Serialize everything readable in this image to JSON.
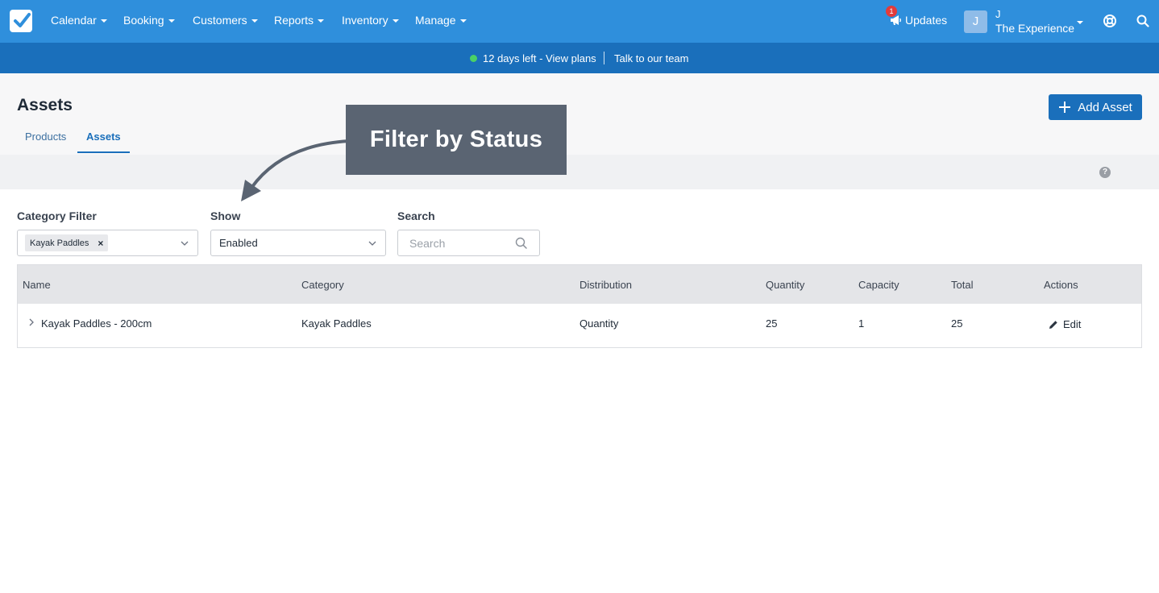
{
  "nav": {
    "items": [
      {
        "label": "Calendar"
      },
      {
        "label": "Booking"
      },
      {
        "label": "Customers"
      },
      {
        "label": "Reports"
      },
      {
        "label": "Inventory"
      },
      {
        "label": "Manage"
      }
    ],
    "updates_label": "Updates",
    "updates_badge": "1",
    "user_avatar_initial": "J",
    "user_name": "J",
    "user_org": "The Experience"
  },
  "banner": {
    "trial_text": "12 days left - View plans",
    "separator": "|",
    "talk_text": "Talk to our team",
    "status_color": "#4ad166"
  },
  "page": {
    "title": "Assets",
    "tabs": [
      {
        "label": "Products",
        "active": false
      },
      {
        "label": "Assets",
        "active": true
      }
    ],
    "add_button_label": "Add Asset",
    "help_glyph": "?"
  },
  "callout": {
    "text": "Filter by Status"
  },
  "filters": {
    "category_label": "Category Filter",
    "category_chip": "Kayak Paddles",
    "chip_remove": "×",
    "show_label": "Show",
    "show_value": "Enabled",
    "search_label": "Search",
    "search_placeholder": "Search"
  },
  "table": {
    "headers": [
      "Name",
      "Category",
      "Distribution",
      "Quantity",
      "Capacity",
      "Total",
      "Actions"
    ],
    "rows": [
      {
        "name": "Kayak Paddles - 200cm",
        "category": "Kayak Paddles",
        "distribution": "Quantity",
        "quantity": "25",
        "capacity": "1",
        "total": "25",
        "action": "Edit"
      }
    ]
  },
  "colors": {
    "topnav": "#2f8fdc",
    "banner": "#1a6fbb",
    "primary": "#1a6fbb",
    "callout": "#5a6472",
    "badge": "#e23b3b"
  },
  "icons": {
    "logo": "checkbox-logo-icon",
    "updates": "megaphone-icon",
    "help": "lifebuoy-icon",
    "search": "search-icon",
    "row_expand": "chevron-right-icon",
    "edit": "pencil-icon"
  }
}
